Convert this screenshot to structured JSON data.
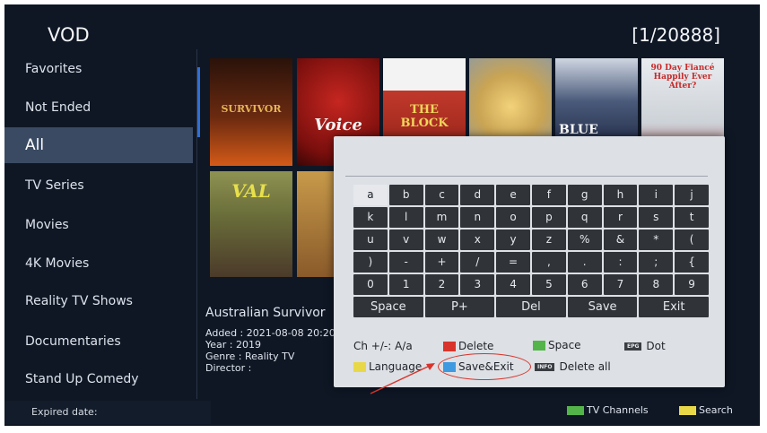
{
  "header": {
    "title": "VOD",
    "counter": "[1/20888]"
  },
  "sidebar": {
    "items": [
      {
        "label": "Favorites"
      },
      {
        "label": "Not Ended"
      },
      {
        "label": "All"
      },
      {
        "label": "TV Series"
      },
      {
        "label": "Movies"
      },
      {
        "label": "4K Movies"
      },
      {
        "label": "Reality TV Shows"
      },
      {
        "label": "Documentaries"
      },
      {
        "label": "Stand Up Comedy"
      }
    ],
    "active_index": 2,
    "expired_label": "Expired date:"
  },
  "posters": [
    {
      "title": "SURVIVOR",
      "color": "#5a2412"
    },
    {
      "title": "Voice",
      "color": "#8d1815"
    },
    {
      "title": "THE BLOCK",
      "color": "#b53528"
    },
    {
      "title": "",
      "color": "#b9a064"
    },
    {
      "title": "BLUE BLOODS",
      "color": "#1d2a4f"
    },
    {
      "title": "90 Day Fiancé Happily Ever After?",
      "color": "#cdd2d8"
    },
    {
      "title": "VAL",
      "color": "#6b6f3a"
    },
    {
      "title": "",
      "color": "#a07a3a"
    }
  ],
  "details": {
    "title": "Australian Survivor",
    "added": "Added : 2021-08-08 20:20",
    "year": "Year : 2019",
    "genre": "Genre : Reality TV",
    "director": "Director :"
  },
  "keyboard": {
    "rows": [
      [
        "a",
        "b",
        "c",
        "d",
        "e",
        "f",
        "g",
        "h",
        "i",
        "j"
      ],
      [
        "k",
        "l",
        "m",
        "n",
        "o",
        "p",
        "q",
        "r",
        "s",
        "t"
      ],
      [
        "u",
        "v",
        "w",
        "x",
        "y",
        "z",
        "%",
        "&",
        "*",
        "("
      ],
      [
        ")",
        "-",
        "+",
        "/",
        "=",
        ",",
        ".",
        ":",
        ";",
        "{"
      ],
      [
        "0",
        "1",
        "2",
        "3",
        "4",
        "5",
        "6",
        "7",
        "8",
        "9"
      ]
    ],
    "bottom_row": [
      "Space",
      "P+",
      "Del",
      "Save",
      "Exit"
    ],
    "selected_key": "a",
    "legend": {
      "case": "Ch +/-:  A/a",
      "delete": "Delete",
      "space": "Space",
      "epg_tag": "EPG",
      "dot": "Dot",
      "language": "Language",
      "save_exit": "Save&Exit",
      "info_tag": "INFO",
      "delete_all": "Delete all"
    }
  },
  "bottom_bar": {
    "tv_channels": "TV Channels",
    "search": "Search"
  },
  "colors": {
    "red": "#d9342b",
    "green": "#53b44a",
    "yellow": "#e8d848",
    "blue": "#3e9ae0",
    "accent": "#2f6fd6"
  }
}
